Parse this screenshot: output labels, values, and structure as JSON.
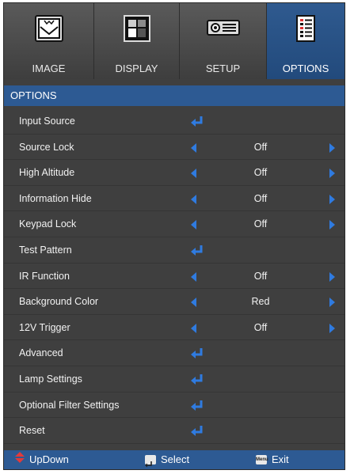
{
  "tabs": [
    {
      "label": "IMAGE",
      "icon": "image-icon"
    },
    {
      "label": "DISPLAY",
      "icon": "display-icon"
    },
    {
      "label": "SETUP",
      "icon": "projector-icon"
    },
    {
      "label": "OPTIONS",
      "icon": "options-document-icon",
      "active": true
    }
  ],
  "section_title": "OPTIONS",
  "rows": [
    {
      "label": "Input Source",
      "type": "enter"
    },
    {
      "label": "Source Lock",
      "type": "value",
      "value": "Off"
    },
    {
      "label": "High Altitude",
      "type": "value",
      "value": "Off"
    },
    {
      "label": "Information Hide",
      "type": "value",
      "value": "Off"
    },
    {
      "label": "Keypad Lock",
      "type": "value",
      "value": "Off"
    },
    {
      "label": "Test Pattern",
      "type": "enter"
    },
    {
      "label": "IR Function",
      "type": "value",
      "value": "Off"
    },
    {
      "label": "Background Color",
      "type": "value",
      "value": "Red"
    },
    {
      "label": "12V Trigger",
      "type": "value",
      "value": "Off"
    },
    {
      "label": "Advanced",
      "type": "enter"
    },
    {
      "label": "Lamp Settings",
      "type": "enter"
    },
    {
      "label": "Optional Filter Settings",
      "type": "enter"
    },
    {
      "label": "Reset",
      "type": "enter"
    }
  ],
  "footer": {
    "updown": "UpDown",
    "select": "Select",
    "exit": "Exit",
    "menu_key": "Menu"
  },
  "colors": {
    "accent_blue": "#2d5a93",
    "arrow_blue": "#2f7be0",
    "updown_red": "#e23a3a"
  }
}
